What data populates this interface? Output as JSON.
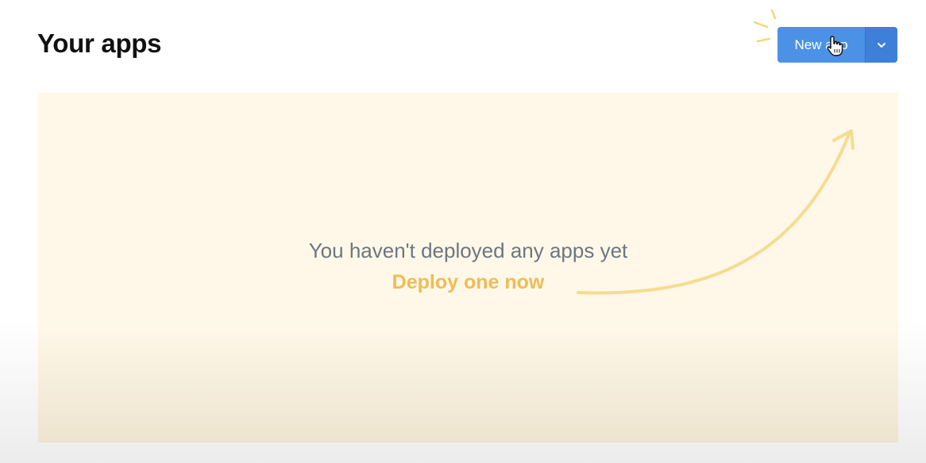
{
  "header": {
    "title": "Your apps",
    "new_app_button": "New app"
  },
  "empty_state": {
    "message": "You haven't deployed any apps yet",
    "cta": "Deploy one now"
  },
  "colors": {
    "primary": "#4b92e6",
    "primary_dark": "#3d7fd9",
    "accent": "#f0bc52",
    "panel_bg": "#fff8e9"
  },
  "icons": [
    "sparkle-icon",
    "chevron-down-icon",
    "hand-cursor-icon",
    "curved-arrow-icon"
  ]
}
